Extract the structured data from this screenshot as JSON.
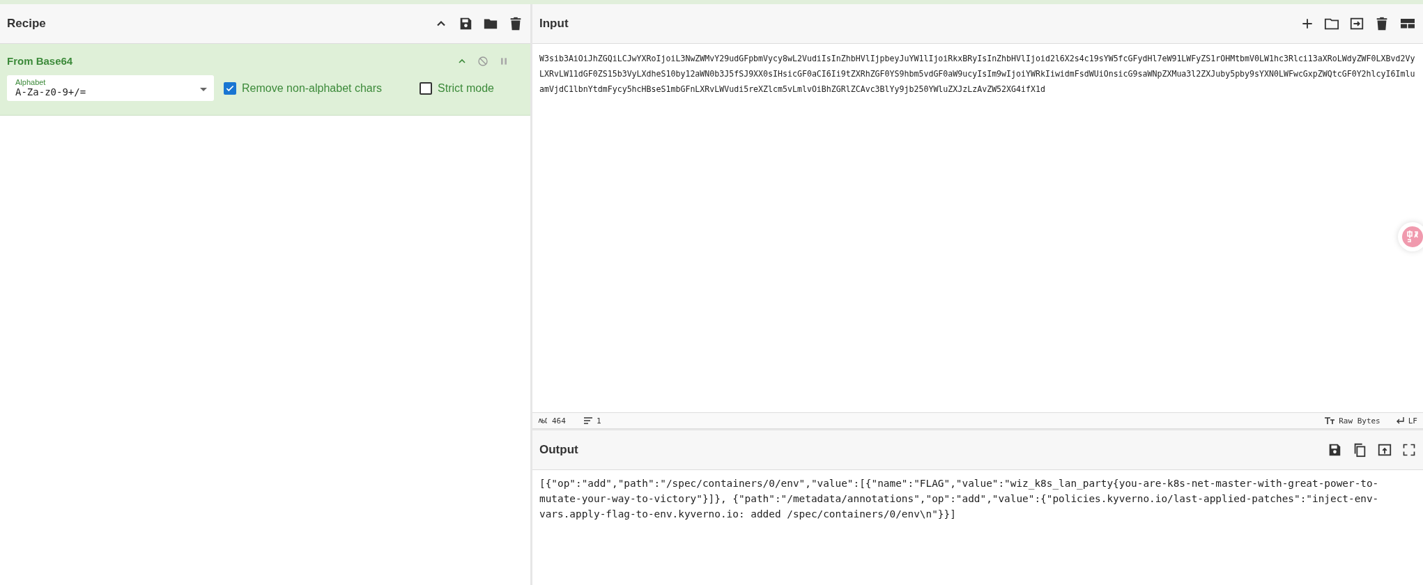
{
  "recipe": {
    "title": "Recipe",
    "operations": [
      {
        "name": "From Base64",
        "args": [
          {
            "kind": "select",
            "label": "Alphabet",
            "value": "A-Za-z0-9+/="
          },
          {
            "kind": "checkbox",
            "label": "Remove non-alphabet chars",
            "checked": true
          },
          {
            "kind": "checkbox",
            "label": "Strict mode",
            "checked": false
          }
        ]
      }
    ]
  },
  "input": {
    "title": "Input",
    "text": "W3sib3AiOiJhZGQiLCJwYXRoIjoiL3NwZWMvY29udGFpbmVycy8wL2VudiIsInZhbHVlIjpbeyJuYW1lIjoiRkxBRyIsInZhbHVlIjoid2l6X2s4c19sYW5fcGFydHl7eW91LWFyZS1rOHMtbmV0LW1hc3Rlci13aXRoLWdyZWF0LXBvd2VyLXRvLW11dGF0ZS15b3VyLXdheS10by12aWN0b3J5fSJ9XX0sIHsicGF0aCI6Ii9tZXRhZGF0YS9hbm5vdGF0aW9ucyIsIm9wIjoiYWRkIiwidmFsdWUiOnsicG9saWNpZXMua3l2ZXJuby5pby9sYXN0LWFwcGxpZWQtcGF0Y2hlcyI6ImluamVjdC1lbnYtdmFycy5hcHBseS1mbGFnLXRvLWVudi5reXZlcm5vLmlvOiBhZGRlZCAvc3BlYy9jb250YWluZXJzLzAvZW52XG4ifX1d",
    "status": {
      "length": "464",
      "lines": "1",
      "encoding": "Raw Bytes",
      "eol": "LF"
    }
  },
  "output": {
    "title": "Output",
    "text": "[{\"op\":\"add\",\"path\":\"/spec/containers/0/env\",\"value\":[{\"name\":\"FLAG\",\"value\":\"wiz_k8s_lan_party{you-are-k8s-net-master-with-great-power-to-mutate-your-way-to-victory\"}]}, {\"path\":\"/metadata/annotations\",\"op\":\"add\",\"value\":{\"policies.kyverno.io/last-applied-patches\":\"inject-env-vars.apply-flag-to-env.kyverno.io: added /spec/containers/0/env\\n\"}}]"
  }
}
